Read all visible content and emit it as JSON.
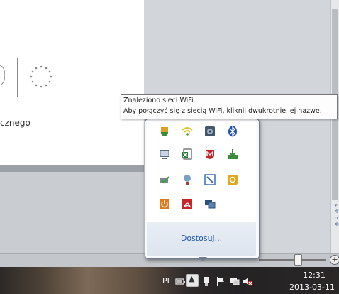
{
  "document": {
    "text_fragment": "cznego"
  },
  "tooltip": {
    "line1": "Znaleziono sieci WiFi.",
    "line2": "Aby połączyć się z siecią WiFi, kliknij dwukrotnie jej nazwę."
  },
  "tray_popup": {
    "customize_label": "Dostosuj...",
    "icons": [
      {
        "name": "shield-icon",
        "color": "#d9a12a"
      },
      {
        "name": "wifi-icon",
        "color": "#e3c52a"
      },
      {
        "name": "speaker-app-icon",
        "color": "#44546a"
      },
      {
        "name": "bluetooth-icon",
        "color": "#1f4fa8"
      },
      {
        "name": "monitor-icon",
        "color": "#5a6b80"
      },
      {
        "name": "document-app-icon",
        "color": "#2d7a3a"
      },
      {
        "name": "mcafee-icon",
        "color": "#c0222a"
      },
      {
        "name": "download-icon",
        "color": "#3a8c3a"
      },
      {
        "name": "network-check-icon",
        "color": "#7a8a9a"
      },
      {
        "name": "lightbulb-icon",
        "color": "#b03a3a"
      },
      {
        "name": "wrench-icon",
        "color": "#3a6fb0"
      },
      {
        "name": "outlook-icon",
        "color": "#e0a81e"
      },
      {
        "name": "power-icon",
        "color": "#e07a20"
      },
      {
        "name": "pdf-icon",
        "color": "#c8252a"
      },
      {
        "name": "network-monitor-icon",
        "color": "#2b4f7a"
      }
    ]
  },
  "taskbar": {
    "language": "PL",
    "clock_time": "12:31",
    "clock_date": "2013-03-11",
    "show_hidden_symbol": "▲"
  },
  "statusbar": {
    "zoom_plus": "+"
  }
}
